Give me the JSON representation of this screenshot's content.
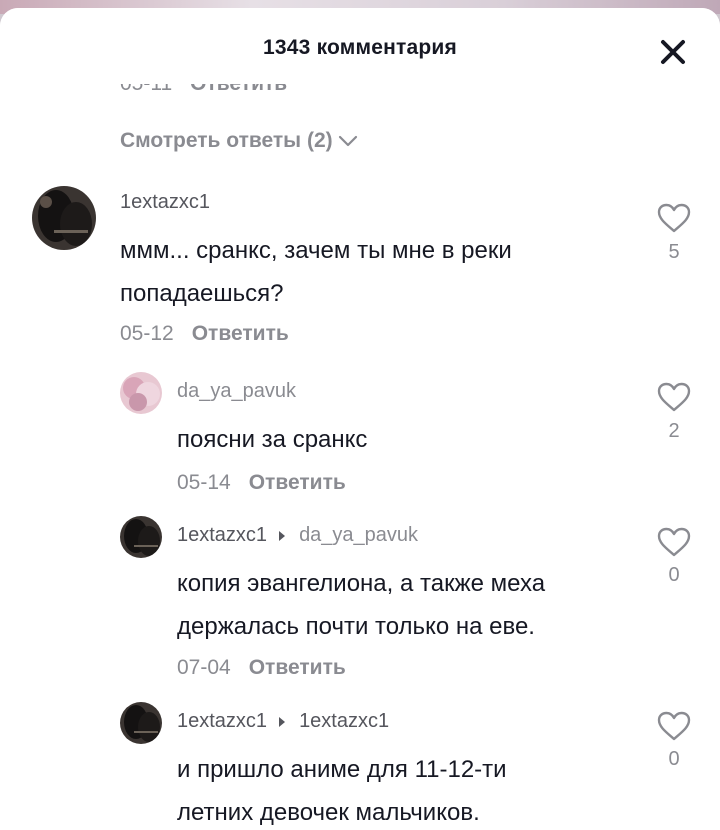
{
  "header": {
    "title": "1343 комментария"
  },
  "prev_comment": {
    "date": "05-11",
    "reply_label": "Ответить"
  },
  "view_replies_label": "Смотреть ответы (2)",
  "comments": [
    {
      "username": "1extazxc1",
      "reply_to": "",
      "lines": [
        "ммм... сранкс, зачем ты мне в реки",
        "попадаешься?"
      ],
      "date": "05-12",
      "reply_label": "Ответить",
      "likes": "5"
    },
    {
      "username": "da_ya_pavuk",
      "reply_to": "",
      "lines": [
        "поясни за сранкс"
      ],
      "date": "05-14",
      "reply_label": "Ответить",
      "likes": "2"
    },
    {
      "username": "1extazxc1",
      "reply_to": "da_ya_pavuk",
      "lines": [
        "копия эвангелиона, а также меха",
        "держалась почти только на еве."
      ],
      "date": "07-04",
      "reply_label": "Ответить",
      "likes": "0"
    },
    {
      "username": "1extazxc1",
      "reply_to": "1extazxc1",
      "lines": [
        "и пришло аниме для 11-12-ти",
        "летних девочек мальчиков."
      ],
      "date": "",
      "reply_label": "",
      "likes": "0"
    }
  ],
  "icons": {
    "close": "close-icon",
    "like": "heart-outline-icon",
    "chevron": "chevron-down-icon",
    "reply_arrow": "caret-right-icon"
  },
  "colors": {
    "text": "#161823",
    "secondary": "#8a8b91",
    "username": "#55565d",
    "background": "#ffffff"
  }
}
